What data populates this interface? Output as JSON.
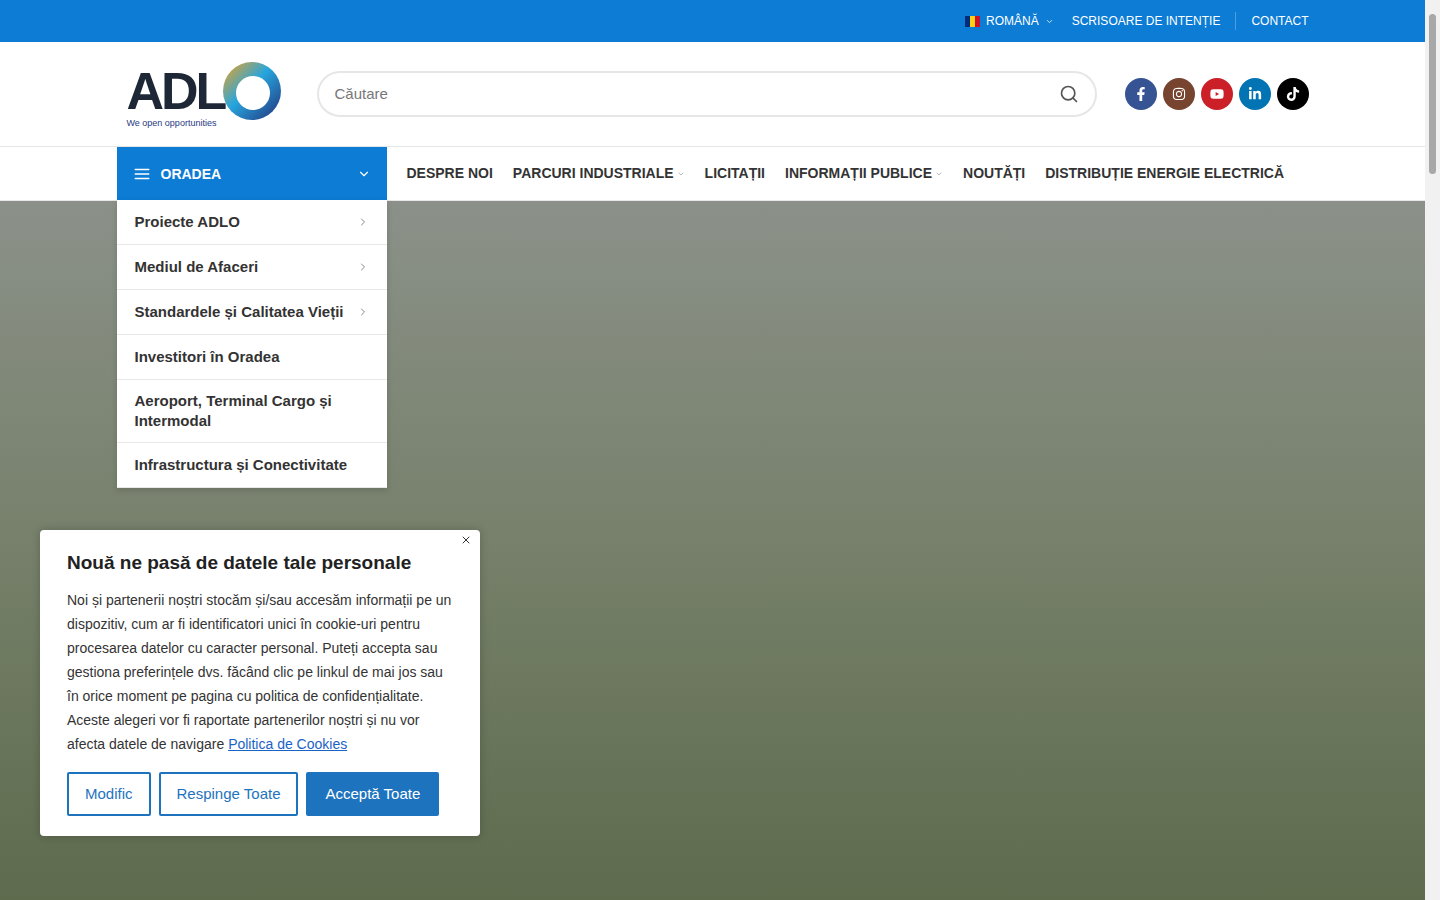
{
  "topbar": {
    "language": "ROMÂNĂ",
    "links": [
      "SCRISOARE DE INTENȚIE",
      "CONTACT"
    ]
  },
  "logo": {
    "letters": "ADL",
    "tagline": "We open opportunities"
  },
  "search": {
    "placeholder": "Căutare"
  },
  "social": [
    {
      "name": "facebook",
      "color": "#365493"
    },
    {
      "name": "instagram",
      "color": "#774430"
    },
    {
      "name": "youtube",
      "color": "#cb2027"
    },
    {
      "name": "linkedin",
      "color": "#0274b3"
    },
    {
      "name": "tiktok",
      "color": "#000000"
    }
  ],
  "category": {
    "label": "ORADEA",
    "expanded": true
  },
  "category_menu": [
    {
      "label": "Proiecte ADLO",
      "has_submenu": true
    },
    {
      "label": "Mediul de Afaceri",
      "has_submenu": true
    },
    {
      "label": "Standardele și Calitatea Vieții",
      "has_submenu": true
    },
    {
      "label": "Investitori în Oradea",
      "has_submenu": false
    },
    {
      "label": "Aeroport, Terminal Cargo și Intermodal",
      "has_submenu": false
    },
    {
      "label": "Infrastructura și Conectivitate",
      "has_submenu": false
    }
  ],
  "nav": [
    {
      "label": "DESPRE NOI",
      "has_dropdown": false
    },
    {
      "label": "PARCURI INDUSTRIALE",
      "has_dropdown": true
    },
    {
      "label": "LICITAȚII",
      "has_dropdown": false
    },
    {
      "label": "INFORMAȚII PUBLICE",
      "has_dropdown": true
    },
    {
      "label": "NOUTĂȚI",
      "has_dropdown": false
    },
    {
      "label": "DISTRIBUȚIE ENERGIE ELECTRICĂ",
      "has_dropdown": false
    }
  ],
  "cookie": {
    "title": "Nouă ne pasă de datele tale personale",
    "body": "Noi și partenerii noștri stocăm și/sau accesăm informații pe un dispozitiv, cum ar fi identificatori unici în cookie-uri pentru procesarea datelor cu caracter personal. Puteți accepta sau gestiona preferințele dvs. făcând clic pe linkul de mai jos sau în orice moment pe pagina cu politica de confidențialitate. Aceste alegeri vor fi raportate partenerilor noștri și nu vor afecta datele de navigare",
    "link": "Politica de Cookies",
    "buttons": [
      {
        "label": "Modific",
        "kind": "outline"
      },
      {
        "label": "Respinge Toate",
        "kind": "outline"
      },
      {
        "label": "Acceptă Toate",
        "kind": "primary"
      }
    ]
  }
}
